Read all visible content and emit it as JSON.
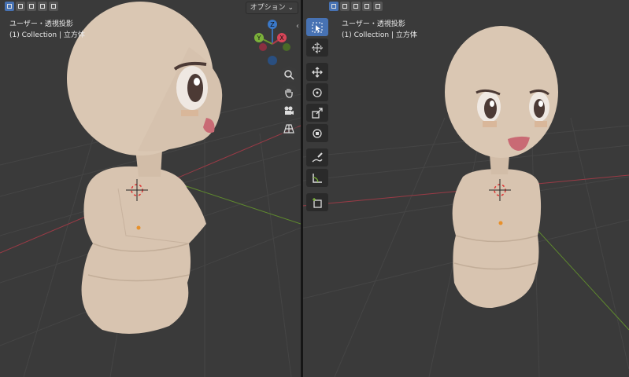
{
  "left_viewport": {
    "view_label": "ユーザー・透視投影",
    "collection_label": "(1) Collection | 立方体",
    "options_label": "オプション",
    "options_chevron": "chevron-down-icon",
    "gizmo": {
      "z_label": "Z",
      "y_label": "Y",
      "x_label": "X"
    },
    "navigation": [
      "zoom-icon",
      "hand-pan-icon",
      "camera-icon",
      "grid-perspective-icon"
    ]
  },
  "right_viewport": {
    "view_label": "ユーザー・透視投影",
    "collection_label": "(1) Collection | 立方体",
    "tools": [
      "select-box-icon",
      "cursor-icon",
      "move-icon",
      "rotate-icon",
      "scale-icon",
      "transform-icon",
      "annotate-icon",
      "measure-icon",
      "add-cube-icon"
    ]
  },
  "colors": {
    "viewport_bg": "#3a3a3a",
    "grid_line": "#474747",
    "x_axis": "#9b3a46",
    "y_axis": "#5f8a2e",
    "skin": "#d8c4b0",
    "active_tool": "#4772b3",
    "origin_dot": "#e8902a"
  }
}
